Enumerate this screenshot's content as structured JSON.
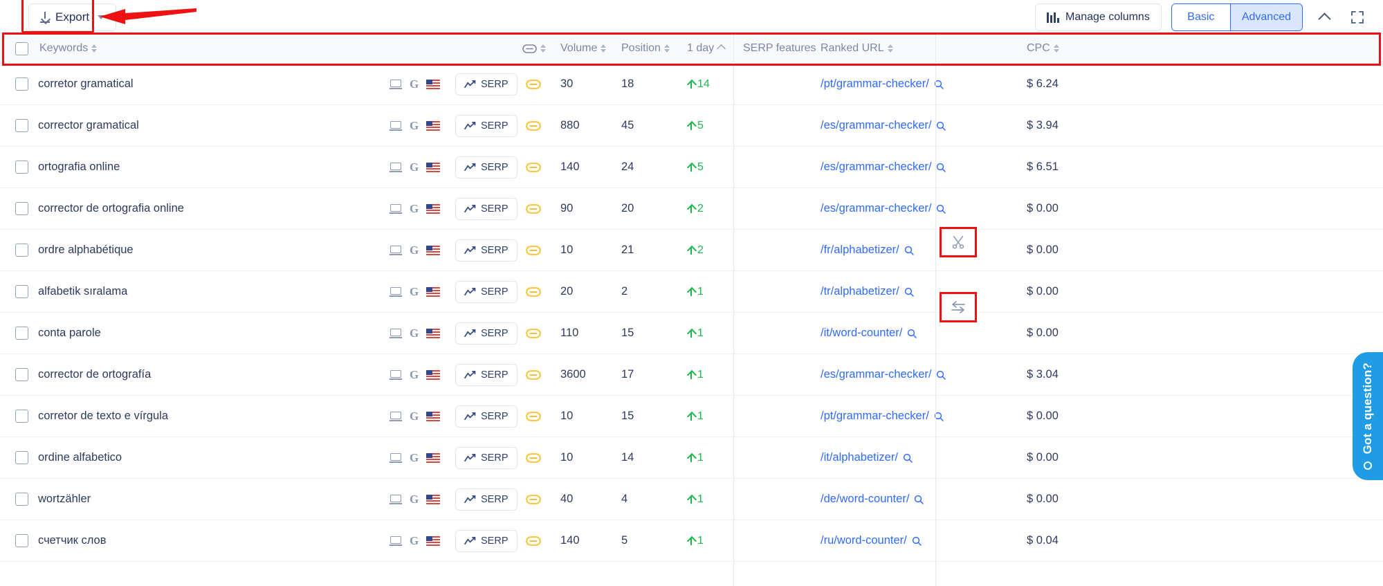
{
  "toolbar": {
    "export_label": "Export",
    "manage_columns_label": "Manage columns",
    "view_basic_label": "Basic",
    "view_advanced_label": "Advanced",
    "collapse_icon": "chevron-up-icon",
    "fullscreen_icon": "expand-icon",
    "export_icon": "download-icon",
    "export_caret": "chevron-down-icon"
  },
  "table": {
    "columns": {
      "keywords": "Keywords",
      "intent": "",
      "volume": "Volume",
      "position": "Position",
      "one_day": "1 day",
      "serp_features": "SERP features",
      "ranked_url": "Ranked URL",
      "cpc": "CPC"
    },
    "sort": {
      "column": "1 day",
      "direction": "asc"
    },
    "rows": [
      {
        "keyword": "corretor gramatical",
        "device": "desktop-icon",
        "engine": "G",
        "country": "us-flag",
        "serp_button": "SERP",
        "link": "link-icon",
        "volume": "30",
        "position": "18",
        "one_day": "14",
        "one_day_dir": "up",
        "serp_feature": "",
        "ranked_url": "/pt/grammar-checker/",
        "cpc": "$ 6.24"
      },
      {
        "keyword": "corrector gramatical",
        "device": "desktop-icon",
        "engine": "G",
        "country": "us-flag",
        "serp_button": "SERP",
        "link": "link-icon",
        "volume": "880",
        "position": "45",
        "one_day": "5",
        "one_day_dir": "up",
        "serp_feature": "",
        "ranked_url": "/es/grammar-checker/",
        "cpc": "$ 3.94"
      },
      {
        "keyword": "ortografia online",
        "device": "desktop-icon",
        "engine": "G",
        "country": "us-flag",
        "serp_button": "SERP",
        "link": "link-icon",
        "volume": "140",
        "position": "24",
        "one_day": "5",
        "one_day_dir": "up",
        "serp_feature": "",
        "ranked_url": "/es/grammar-checker/",
        "cpc": "$ 6.51"
      },
      {
        "keyword": "corrector de ortografia online",
        "device": "desktop-icon",
        "engine": "G",
        "country": "us-flag",
        "serp_button": "SERP",
        "link": "link-icon",
        "volume": "90",
        "position": "20",
        "one_day": "2",
        "one_day_dir": "up",
        "serp_feature": "",
        "ranked_url": "/es/grammar-checker/",
        "cpc": "$ 0.00"
      },
      {
        "keyword": "ordre alphabétique",
        "device": "desktop-icon",
        "engine": "G",
        "country": "us-flag",
        "serp_button": "SERP",
        "link": "link-icon",
        "volume": "10",
        "position": "21",
        "one_day": "2",
        "one_day_dir": "up",
        "serp_feature": "",
        "ranked_url": "/fr/alphabetizer/",
        "cpc": "$ 0.00"
      },
      {
        "keyword": "alfabetik sıralama",
        "device": "desktop-icon",
        "engine": "G",
        "country": "us-flag",
        "serp_button": "SERP",
        "link": "link-icon",
        "volume": "20",
        "position": "2",
        "one_day": "1",
        "one_day_dir": "up",
        "serp_feature": "scissors-icon",
        "ranked_url": "/tr/alphabetizer/",
        "cpc": "$ 0.00"
      },
      {
        "keyword": "conta parole",
        "device": "desktop-icon",
        "engine": "G",
        "country": "us-flag",
        "serp_button": "SERP",
        "link": "link-icon",
        "volume": "110",
        "position": "15",
        "one_day": "1",
        "one_day_dir": "up",
        "serp_feature": "",
        "ranked_url": "/it/word-counter/",
        "cpc": "$ 0.00"
      },
      {
        "keyword": "corrector de ortografía",
        "device": "desktop-icon",
        "engine": "G",
        "country": "us-flag",
        "serp_button": "SERP",
        "link": "link-icon",
        "volume": "3600",
        "position": "17",
        "one_day": "1",
        "one_day_dir": "up",
        "serp_feature": "translate-arrows-icon",
        "ranked_url": "/es/grammar-checker/",
        "cpc": "$ 3.04"
      },
      {
        "keyword": "corretor de texto e vírgula",
        "device": "desktop-icon",
        "engine": "G",
        "country": "us-flag",
        "serp_button": "SERP",
        "link": "link-icon",
        "volume": "10",
        "position": "15",
        "one_day": "1",
        "one_day_dir": "up",
        "serp_feature": "",
        "ranked_url": "/pt/grammar-checker/",
        "cpc": "$ 0.00"
      },
      {
        "keyword": "ordine alfabetico",
        "device": "desktop-icon",
        "engine": "G",
        "country": "us-flag",
        "serp_button": "SERP",
        "link": "link-icon",
        "volume": "10",
        "position": "14",
        "one_day": "1",
        "one_day_dir": "up",
        "serp_feature": "",
        "ranked_url": "/it/alphabetizer/",
        "cpc": "$ 0.00"
      },
      {
        "keyword": "wortzähler",
        "device": "desktop-icon",
        "engine": "G",
        "country": "us-flag",
        "serp_button": "SERP",
        "link": "link-icon",
        "volume": "40",
        "position": "4",
        "one_day": "1",
        "one_day_dir": "up",
        "serp_feature": "",
        "ranked_url": "/de/word-counter/",
        "cpc": "$ 0.00"
      },
      {
        "keyword": "счетчик слов",
        "device": "desktop-icon",
        "engine": "G",
        "country": "us-flag",
        "serp_button": "SERP",
        "link": "link-icon",
        "volume": "140",
        "position": "5",
        "one_day": "1",
        "one_day_dir": "up",
        "serp_feature": "",
        "ranked_url": "/ru/word-counter/",
        "cpc": "$ 0.04"
      }
    ]
  },
  "chat_widget": {
    "label": "Got a question?"
  },
  "colors": {
    "accent_blue": "#2f6bff",
    "green_up": "#1fb650",
    "annotation_red": "#ee1111",
    "link_yellow": "#fbc02d",
    "chat_blue": "#1f9ce4"
  }
}
